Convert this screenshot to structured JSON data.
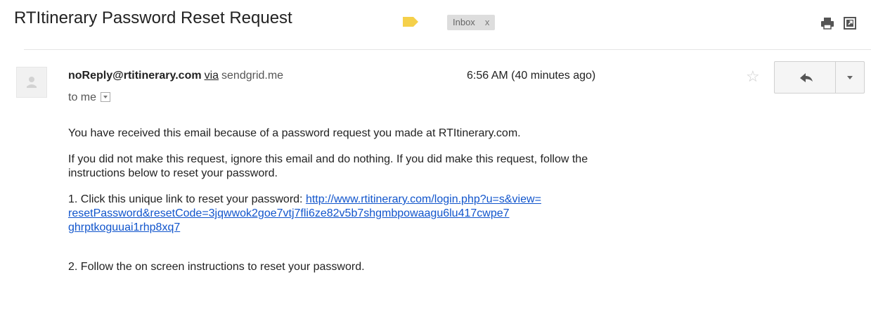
{
  "email": {
    "subject": "RTItinerary Password Reset Request",
    "label_chip": "Inbox",
    "label_chip_remove": "x",
    "label_tag_color": "#f5d04a",
    "sender_email": "noReply@rtitinerary.com",
    "via_text": "via",
    "via_domain": "sendgrid.me",
    "recipient_text": "to me",
    "timestamp": "6:56 AM (40 minutes ago)",
    "body": {
      "line1": "You have received this email because of a password request you made at RTItinerary.com.",
      "line2": "If you did not make this request, ignore this email and do nothing. If you did make this request, follow the",
      "line2b": "instructions below to reset your password.",
      "step1_prefix": "1. Click this unique link to reset your password: ",
      "link_line1": "http://www.rtitinerary.com/login.php?u=s&view=",
      "link_line2": "resetPassword&resetCode=3jqwwok2goe7vtj7fli6ze82v5b7shgmbpowaagu6lu417cwpe7",
      "link_line3": "ghrptkoguuai1rhp8xq7",
      "step2": "2. Follow the on screen instructions to reset your password."
    }
  },
  "icons": {
    "print": "print-icon",
    "new_window": "new-window-icon",
    "star": "star-icon",
    "reply": "reply-icon",
    "more": "chevron-down-icon",
    "avatar": "avatar-placeholder-icon"
  },
  "colors": {
    "link": "#1155cc",
    "chip_bg": "#dddddd",
    "label_tag": "#f5d04a"
  }
}
